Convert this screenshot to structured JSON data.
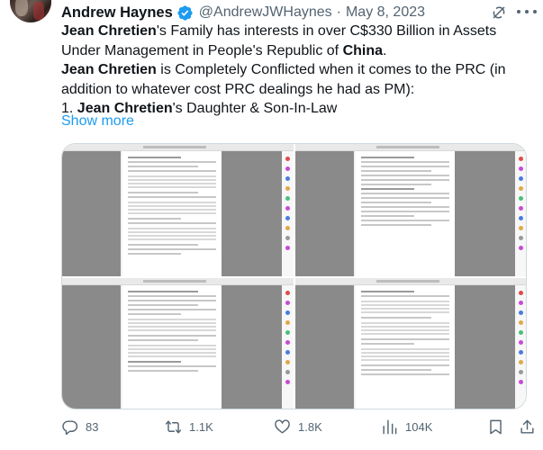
{
  "author": {
    "name": "Andrew Haynes",
    "handle": "@AndrewJWHaynes",
    "separator": "·",
    "date": "May 8, 2023"
  },
  "tweet": {
    "line1": {
      "b1": "Jean Chretien",
      "t1": "'s Family has interests in over C$330 Billion in Assets Under Management in People's Republic of ",
      "b2": "China",
      "t2": "."
    },
    "line2": {
      "b1": "Jean Chretien",
      "t1": " is Completely Conflicted when it comes to the PRC (in addition to whatever cost PRC dealings he had as PM):"
    },
    "line3": {
      "t0": "1. ",
      "b1": "Jean Chretien",
      "t1": "'s Daughter & Son-In-Law"
    },
    "show_more": "Show more"
  },
  "media": {
    "count": 4
  },
  "actions": {
    "replies": "83",
    "reposts": "1.1K",
    "likes": "1.8K",
    "views": "104K"
  },
  "colors": {
    "accent": "#1d9bf0",
    "muted": "#536471",
    "text": "#0f1419"
  },
  "icons": [
    "verified-badge-icon",
    "grok-icon",
    "more-icon",
    "reply-icon",
    "retweet-icon",
    "like-icon",
    "views-icon",
    "bookmark-icon",
    "share-icon"
  ]
}
